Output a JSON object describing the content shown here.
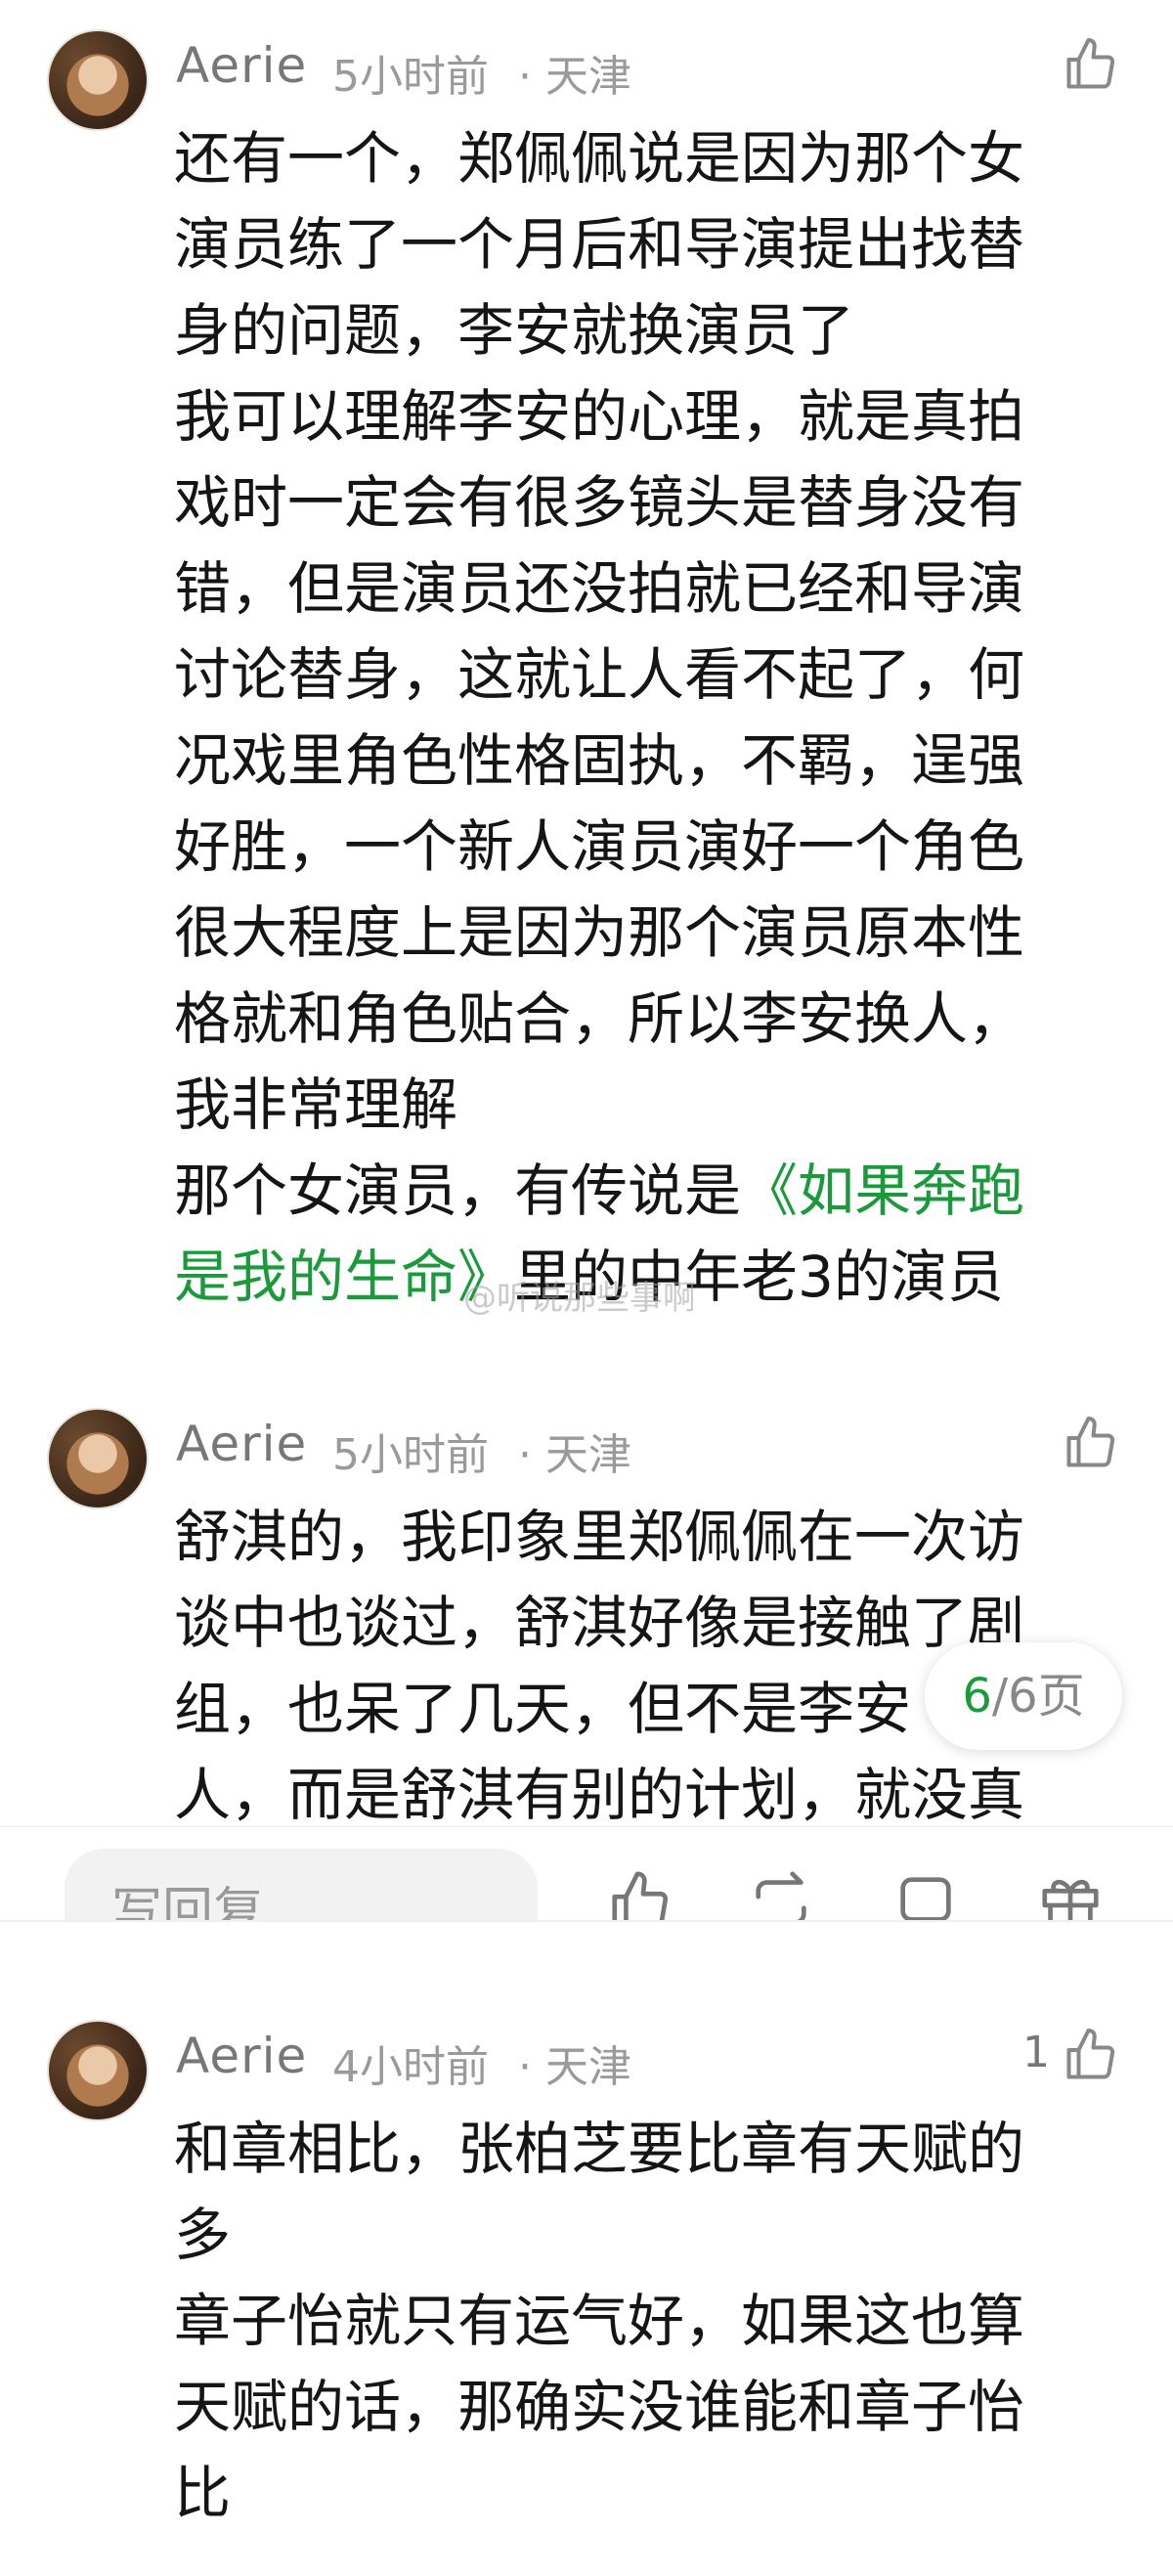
{
  "comments": [
    {
      "author": "Aerie",
      "time": "5小时前",
      "location": "· 天津",
      "likes": "",
      "lines": [
        "还有一个，郑佩佩说是因为那个女",
        "演员练了一个月后和导演提出找替",
        "身的问题，李安就换演员了",
        "我可以理解李安的心理，就是真拍",
        "戏时一定会有很多镜头是替身没有",
        "错，但是演员还没拍就已经和导演",
        "讨论替身，这就让人看不起了，何",
        "况戏里角色性格固执，不羁，逞强",
        "好胜，一个新人演员演好一个角色",
        "很大程度上是因为那个演员原本性",
        "格就和角色贴合，所以李安换人，",
        "我非常理解",
        "那个女演员，有传说是"
      ],
      "link_part1": "《如果奔跑",
      "link_part2": "是我的生命》",
      "after_link": "里的中年老3的演员"
    },
    {
      "author": "Aerie",
      "time": "5小时前",
      "location": "· 天津",
      "likes": "",
      "lines": [
        "舒淇的，我印象里郑佩佩在一次访",
        "谈中也谈过，舒淇好像是接触了剧",
        "组，也呆了几天，但不是李安",
        "人，而是舒淇有别的计划，就没真"
      ]
    },
    {
      "author": "Aerie",
      "time": "4小时前",
      "location": "· 天津",
      "likes": "1",
      "lines": [
        "和章相比，张柏芝要比章有天赋的",
        "多",
        "章子怡就只有运气好，如果这也算",
        "天赋的话，那确实没谁能和章子怡",
        "比"
      ]
    }
  ],
  "watermark": "@听说那些事啊",
  "page_indicator": {
    "current": "6",
    "total": "/6页"
  },
  "reply_bar": {
    "placeholder": "写回复"
  },
  "icons": [
    "thumbs-up-icon",
    "repost-icon",
    "comment-icon",
    "gift-icon"
  ],
  "colors": {
    "link": "#1b9a3c",
    "meta": "#9a9a9a"
  }
}
